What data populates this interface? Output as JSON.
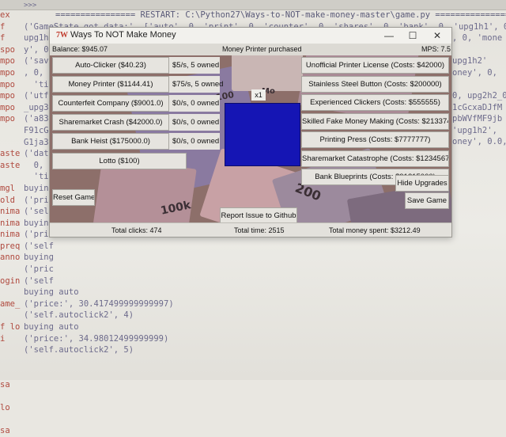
{
  "shell": {
    "prompt": ">>>",
    "restart_line": "================ RESTART: C:\\Python27\\Ways-to-NOT-make-money-master\\game.py ================",
    "gutter": [
      "ex",
      "f",
      "f",
      "spo",
      "mpo",
      "mpo",
      "mpo",
      "mpo",
      "mpo",
      "mpo",
      "",
      "",
      "aste",
      "aste",
      "",
      "mgl",
      "old",
      "nimat",
      "nimat",
      "nimat",
      "prequ",
      "annot",
      "",
      "ogin",
      "",
      "ame_s",
      "",
      "f lo",
      "  i",
      "",
      "",
      "",
      "  sa",
      "",
      "  lo",
      "",
      "  sa"
    ],
    "lines": [
      "('GameState got data:', ['auto', 0, 'print', 0, 'counter', 0, 'shares', 0, 'bank', 0, 'upg1h1', 0,",
      "upg1h",
      "y', 0,",
      "('sav",
      ", 0,",
      "  'ti",
      "('utf",
      "_upg3",
      "('a83",
      "F91cG",
      "G1ja3",
      "('dat",
      "  0, 'v",
      "  'tim",
      "buying",
      "('pric",
      "('self",
      "buying",
      "('pric",
      "('self",
      "buying",
      "('pric",
      "('self",
      "buying auto",
      "('price:', 30.417499999999997)",
      "('self.autoclick2', 4)",
      "buying auto",
      "('price:', 34.98012499999999)",
      "('self.autoclick2', 5)"
    ],
    "right_fragments": [
      ", 0, 'mone",
      "upg1h2'",
      "oney', 0,",
      "0, upg2h2_0",
      "1cGcxaDJfM",
      "pbWVfMF9jb",
      "'upg1h2',",
      "oney', 0.0,"
    ]
  },
  "window": {
    "title": "Ways To NOT Make Money",
    "icon_glyph": "7W",
    "controls": {
      "minimize": "—",
      "maximize": "☐",
      "close": "✕"
    }
  },
  "stats": {
    "balance": "Balance: $945.07",
    "message": "Money Printer purchased",
    "mps": "MPS: 7.5",
    "multiplier": "x1"
  },
  "generators": [
    {
      "label": "Auto-Clicker ($40.23)",
      "rate": "$5/s, 5 owned"
    },
    {
      "label": "Money Printer ($1144.41)",
      "rate": "$75/s, 5 owned"
    },
    {
      "label": "Counterfeit Company ($9001.0)",
      "rate": "$0/s, 0 owned"
    },
    {
      "label": "Sharemarket Crash ($42000.0)",
      "rate": "$0/s, 0 owned"
    },
    {
      "label": "Bank Heist ($175000.0)",
      "rate": "$0/s, 0 owned"
    }
  ],
  "lotto_label": "Lotto ($100)",
  "upgrades": [
    "Unofficial Printer License (Costs: $42000)",
    "Stainless Steel Button (Costs: $200000)",
    "Experienced Clickers (Costs: $555555)",
    "Skilled Fake Money Making (Costs: $2133748)",
    "Printing Press (Costs: $7777777)",
    "Sharemarket Catastrophe (Costs: $12345678)",
    "Bank Blueprints (Costs: $91215000)"
  ],
  "actions": {
    "hide_upgrades": "Hide Upgrades",
    "save_game": "Save Game",
    "reset_game": "Reset Game",
    "report_issue": "Report Issue to Github"
  },
  "status": {
    "total_clicks": "Total clicks: 474",
    "total_time": "Total time: 2515",
    "total_spent": "Total money spent: $3212.49"
  },
  "background_bill_labels": [
    "100k",
    "200",
    "100",
    "Mo",
    "100"
  ],
  "colors": {
    "click_button": "#1515b4",
    "app_icon": "#c0392b",
    "shell_text": "#6d6b8c",
    "gutter_text": "#b04a3f"
  }
}
